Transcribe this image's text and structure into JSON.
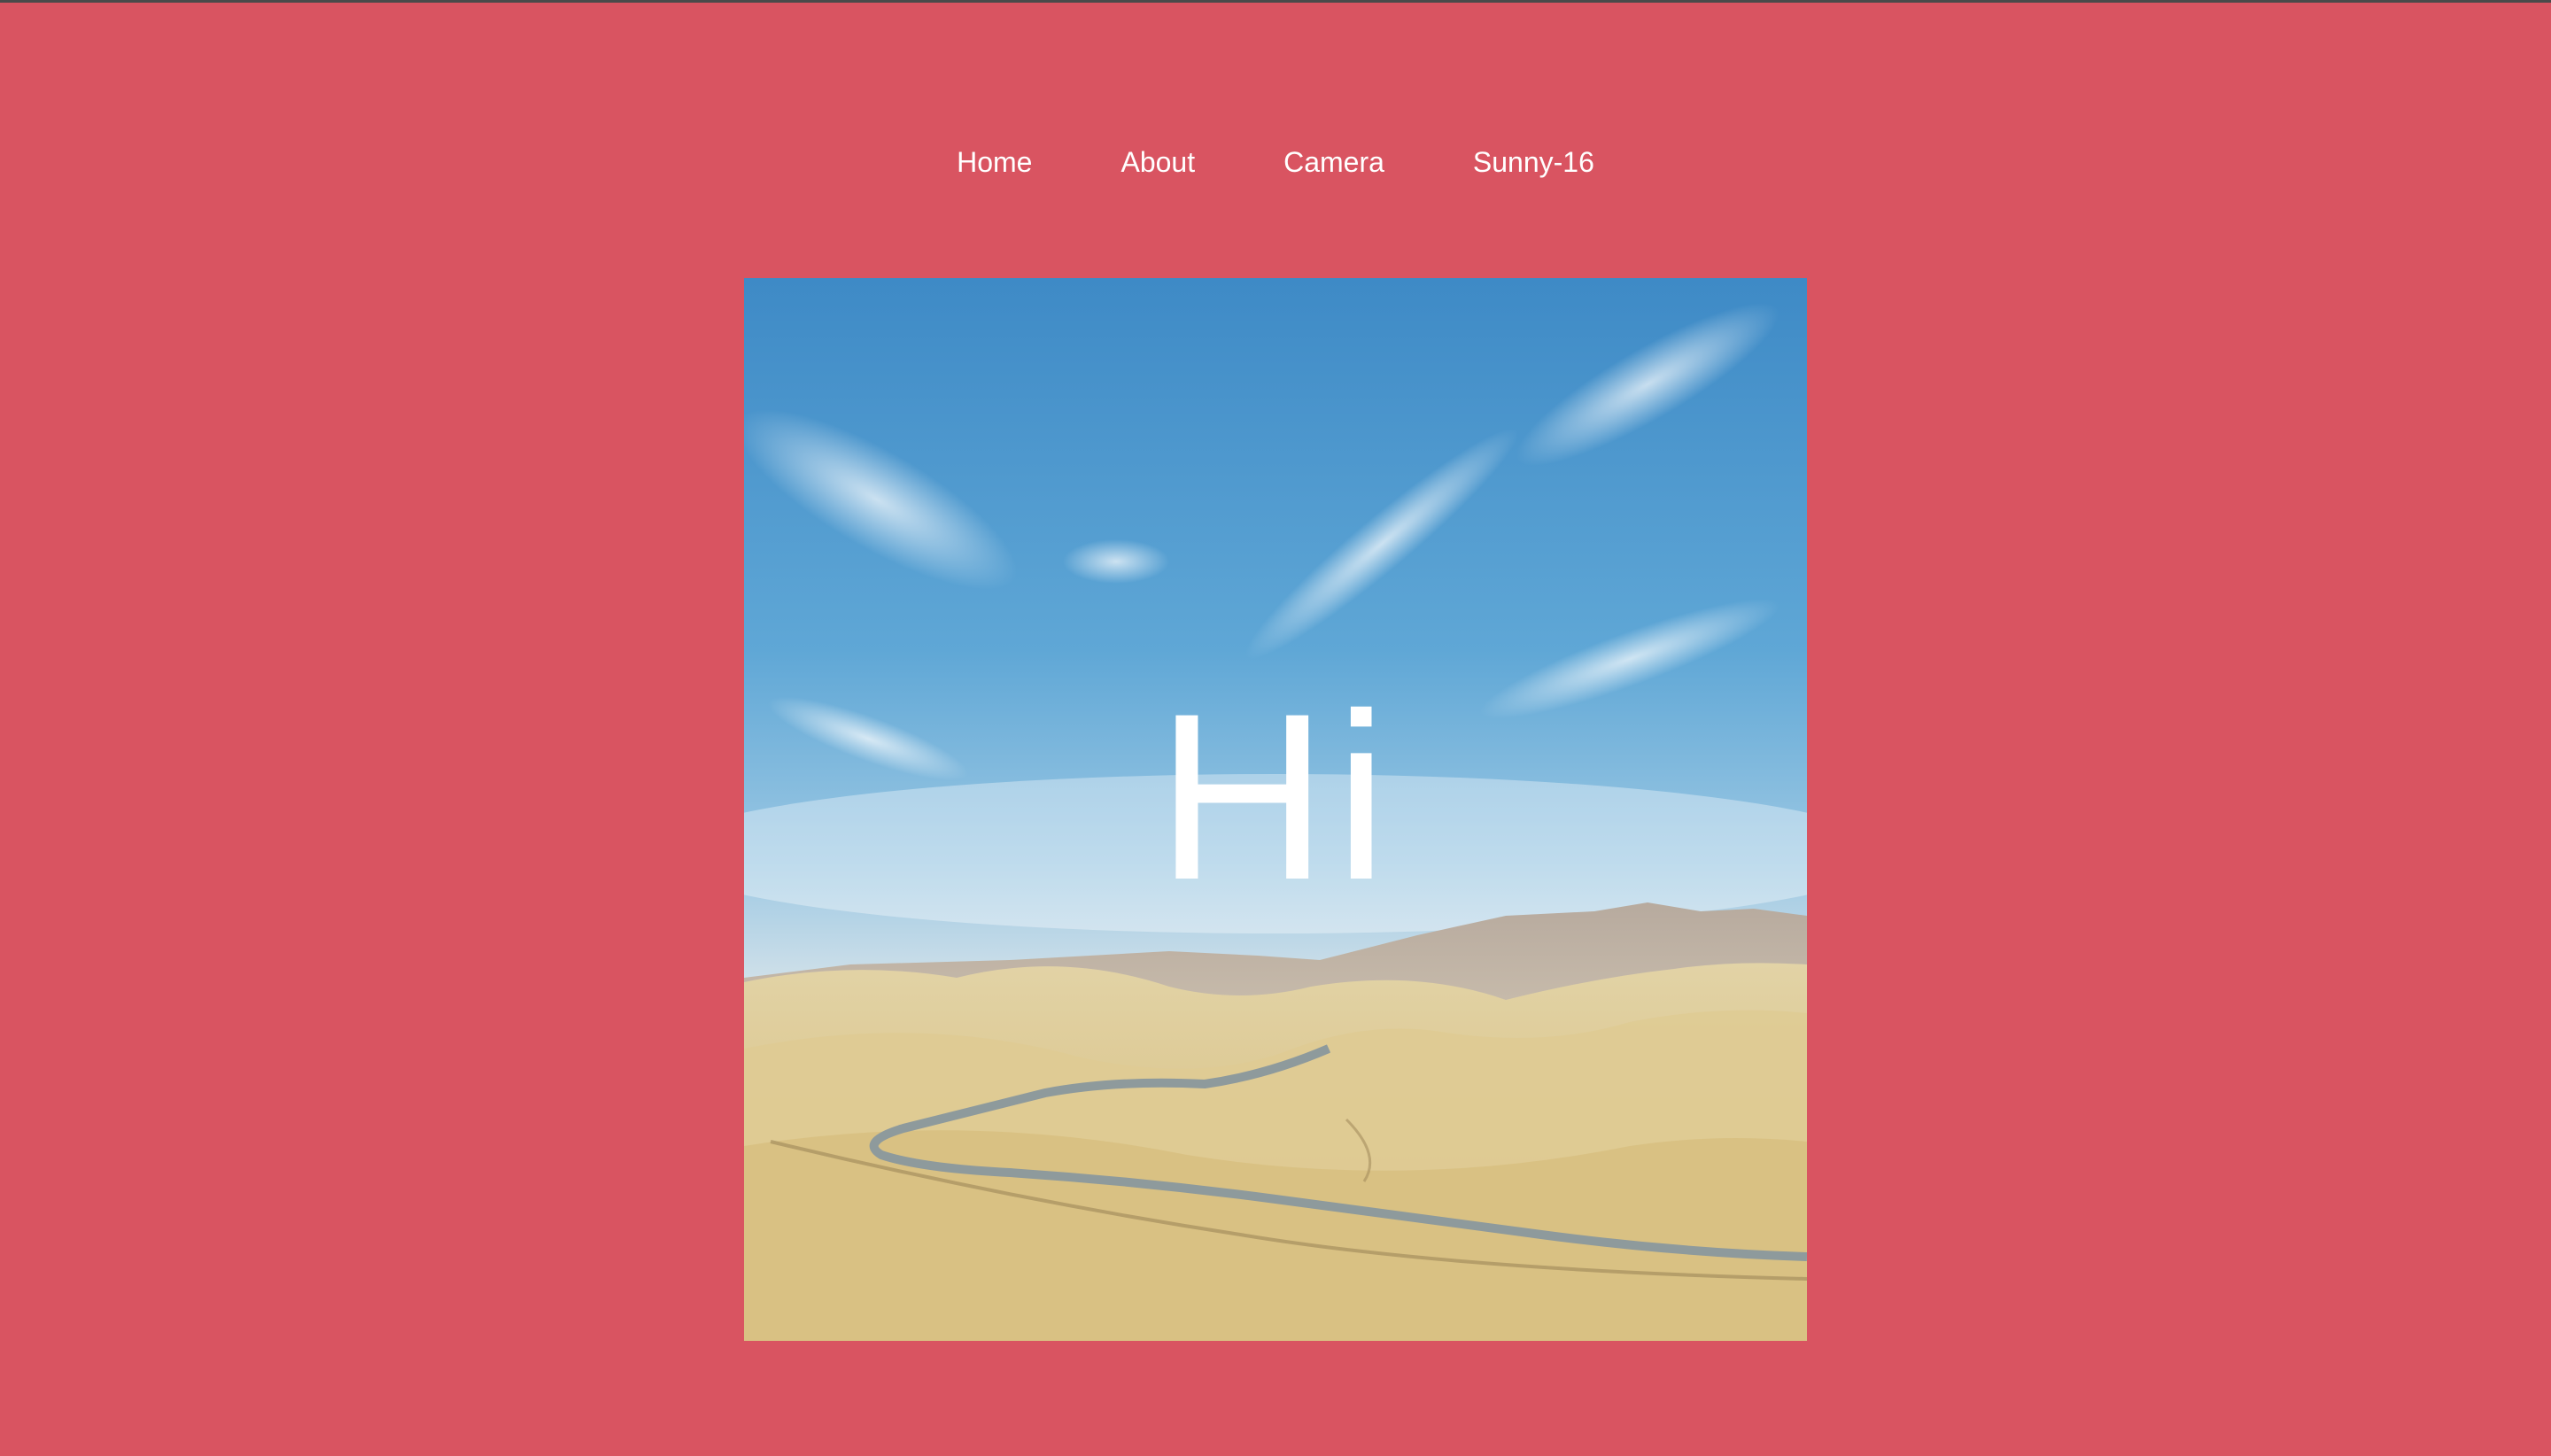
{
  "nav": {
    "items": [
      {
        "label": "Home"
      },
      {
        "label": "About"
      },
      {
        "label": "Camera"
      },
      {
        "label": "Sunny-16"
      }
    ]
  },
  "hero": {
    "heading": "Hi",
    "image": "desert-landscape-photo"
  },
  "colors": {
    "background": "#d95461",
    "text": "#ffffff",
    "sky_top": "#3f8fc9",
    "land": "#dcc68e"
  }
}
